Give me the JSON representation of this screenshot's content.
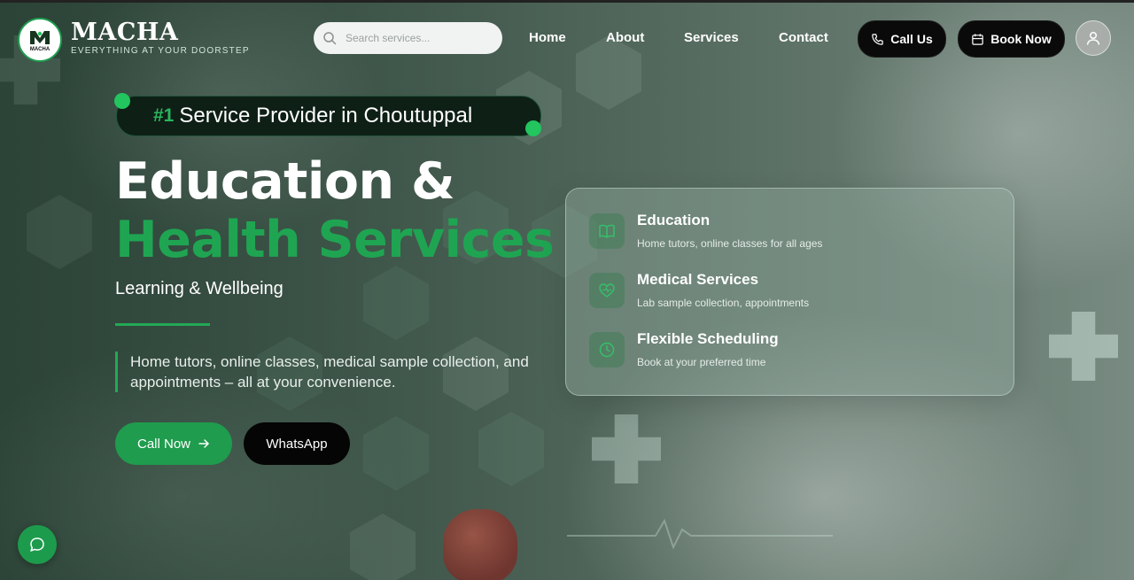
{
  "brand": {
    "badge_text": "MACHA",
    "name": "MACHA",
    "tagline": "EVERYTHING AT YOUR DOORSTEP"
  },
  "search": {
    "placeholder": "Search services..."
  },
  "nav": {
    "links": [
      "Home",
      "About",
      "Services",
      "Contact"
    ],
    "call_label": "Call Us",
    "book_label": "Book Now"
  },
  "hero": {
    "badge_number": "#1",
    "badge_text": "Service Provider in Choutuppal",
    "title_line1": "Education &",
    "title_line2": "Health Services",
    "subtitle": "Learning & Wellbeing",
    "description": "Home tutors, online classes, medical sample collection, and appointments – all at your convenience.",
    "cta_primary": "Call Now",
    "cta_secondary": "WhatsApp"
  },
  "services": [
    {
      "title": "Education",
      "desc": "Home tutors, online classes for all ages",
      "icon": "book-icon"
    },
    {
      "title": "Medical Services",
      "desc": "Lab sample collection, appointments",
      "icon": "heart-icon"
    },
    {
      "title": "Flexible Scheduling",
      "desc": "Book at your preferred time",
      "icon": "clock-icon"
    }
  ],
  "colors": {
    "accent_green": "#1fa552",
    "button_black": "#0a0a0a",
    "badge_dark": "#0e1f16"
  }
}
